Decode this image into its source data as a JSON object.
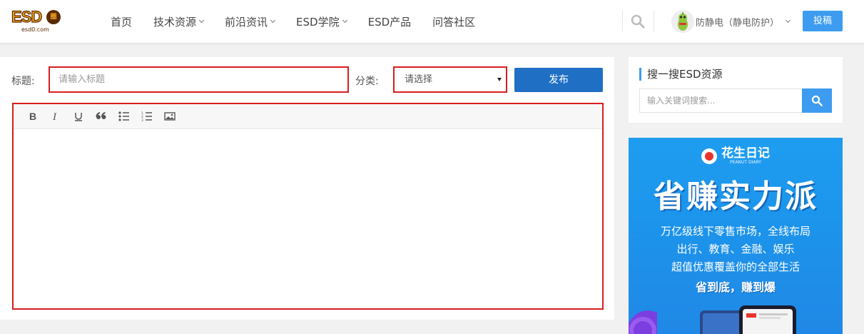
{
  "header": {
    "logo": {
      "main": "ESD",
      "badge": "圈",
      "sub": "esd0.com"
    },
    "nav": [
      {
        "label": "首页",
        "has_caret": false
      },
      {
        "label": "技术资源",
        "has_caret": true
      },
      {
        "label": "前沿资讯",
        "has_caret": true
      },
      {
        "label": "ESD学院",
        "has_caret": true
      },
      {
        "label": "ESD产品",
        "has_caret": false
      },
      {
        "label": "问答社区",
        "has_caret": false
      }
    ],
    "user_name": "防静电（静电防护）",
    "submit_label": "投稿"
  },
  "form": {
    "title_label": "标题:",
    "title_placeholder": "请输入标题",
    "category_label": "分类:",
    "category_selected": "请选择",
    "publish_label": "发布"
  },
  "editor": {
    "toolbar": [
      {
        "name": "bold",
        "icon": "bold-icon"
      },
      {
        "name": "italic",
        "icon": "italic-icon"
      },
      {
        "name": "underline",
        "icon": "underline-icon"
      },
      {
        "name": "quote",
        "icon": "quote-icon"
      },
      {
        "name": "bullet-list",
        "icon": "bullet-list-icon"
      },
      {
        "name": "numbered-list",
        "icon": "numbered-list-icon"
      },
      {
        "name": "image",
        "icon": "image-icon"
      }
    ],
    "content": ""
  },
  "sidebar": {
    "search_title": "搜一搜ESD资源",
    "search_placeholder": "输入关键词搜索..."
  },
  "ad": {
    "brand": "花生日记",
    "brand_sub": "PEANUT DIARY",
    "headline": "省赚实力派",
    "lines": [
      "万亿级线下零售市场，全线布局",
      "出行、教育、金融、娱乐",
      "超值优惠覆盖你的全部生活"
    ],
    "slogan": "省到底，赚到爆"
  },
  "colors": {
    "accent": "#3d9cf0",
    "publish": "#1f6fc5",
    "highlight_border": "#d81e1e",
    "background": "#f1f1f1"
  }
}
